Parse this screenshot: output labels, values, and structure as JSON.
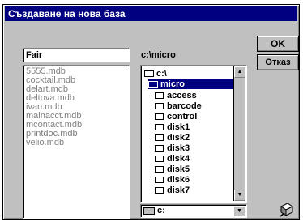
{
  "dialog": {
    "title": "Създаване на нова база",
    "filename_value": "Fair",
    "path_label": "c:\\micro",
    "files": [
      "5555.mdb",
      "cocktail.mdb",
      "delart.mdb",
      "deltova.mdb",
      "ivan.mdb",
      "mainacct.mdb",
      "mcontact.mdb",
      "printdoc.mdb",
      "velio.mdb"
    ],
    "dirs": {
      "root": "c:\\",
      "current": "micro",
      "children": [
        "access",
        "barcode",
        "control",
        "disk1",
        "disk2",
        "disk3",
        "disk4",
        "disk5",
        "disk6",
        "disk7"
      ]
    },
    "drive": "c:",
    "ok_label": "OK",
    "cancel_label": "Отказ"
  },
  "colors": {
    "title_bg": "#000080",
    "face": "#c0c0c0",
    "disabled_text": "#808080"
  }
}
